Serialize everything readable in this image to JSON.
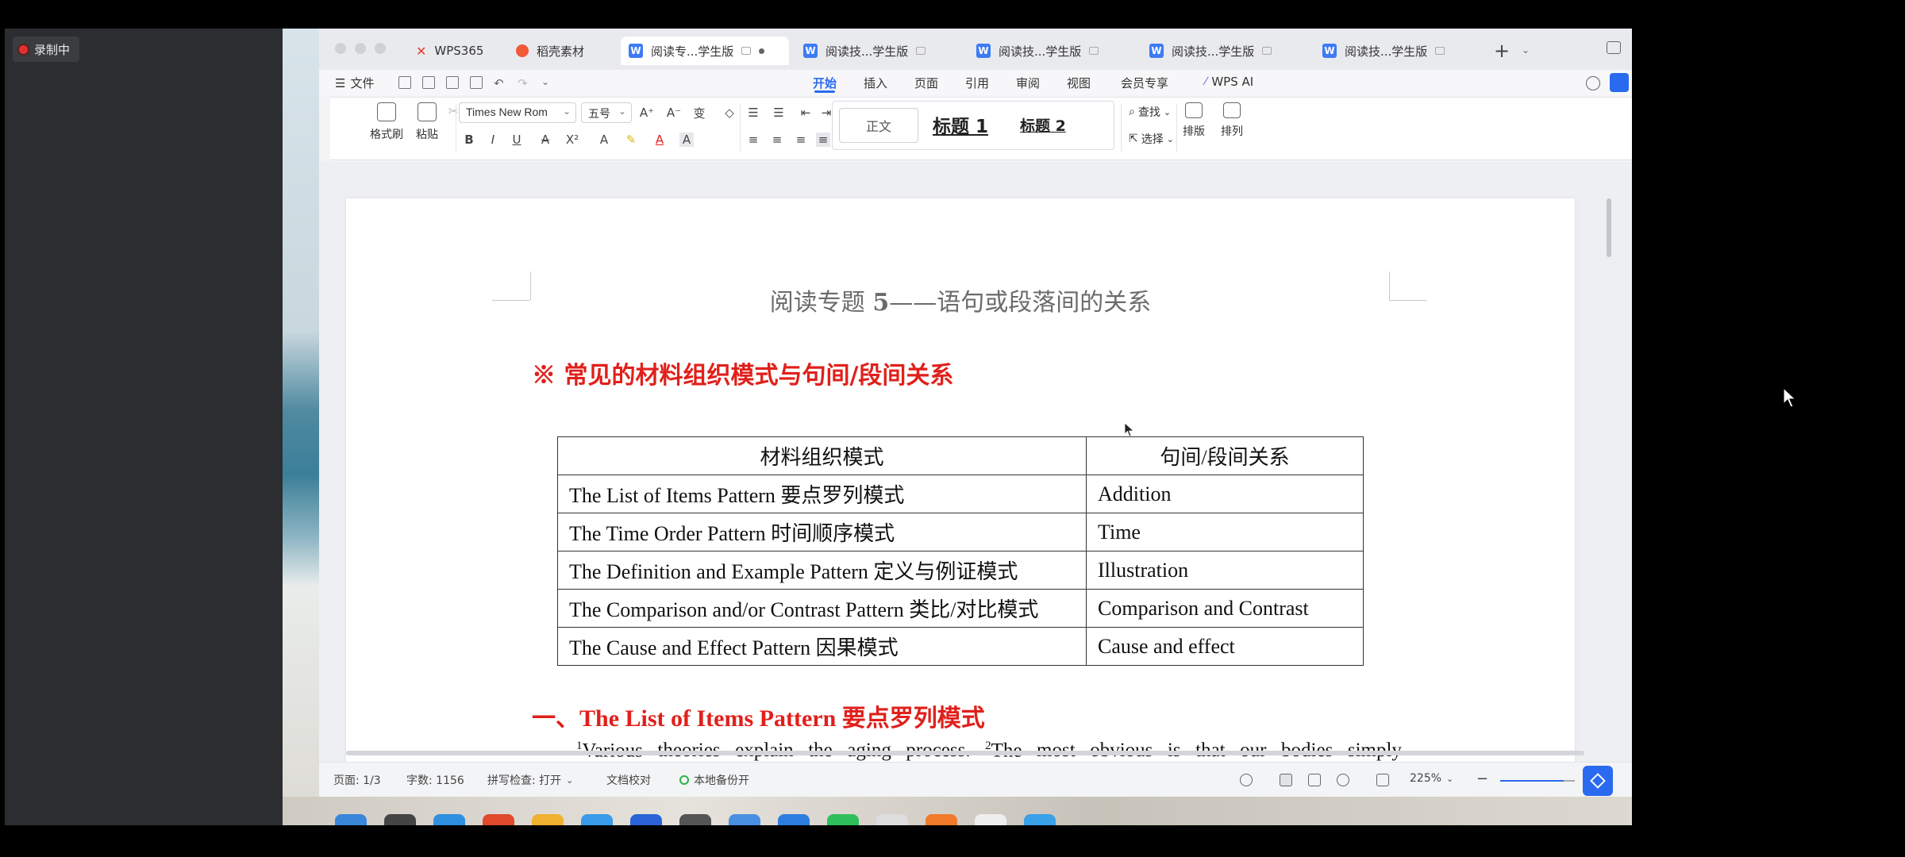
{
  "recorder": {
    "label": "录制中"
  },
  "tabs": [
    {
      "label": "WPS365"
    },
    {
      "label": "稻壳素材"
    },
    {
      "label": "阅读专...学生版",
      "icon": "W"
    },
    {
      "label": "阅读技...学生版",
      "icon": "W"
    },
    {
      "label": "阅读技...学生版",
      "icon": "W"
    },
    {
      "label": "阅读技...学生版",
      "icon": "W"
    },
    {
      "label": "阅读技...学生版",
      "icon": "W"
    }
  ],
  "new_tab": "+",
  "menu": {
    "file": "文件",
    "items": [
      "开始",
      "插入",
      "页面",
      "引用",
      "审阅",
      "视图",
      "会员专享"
    ],
    "ai": "WPS AI"
  },
  "ribbon": {
    "format_painter": "格式刷",
    "paste": "粘贴",
    "font_name": "Times New Rom",
    "font_size": "五号",
    "style_normal": "正文",
    "style_h1": "标题 1",
    "style_h2": "标题 2",
    "find": "查找",
    "select": "选择",
    "layout": "排版",
    "arrange": "排列"
  },
  "document": {
    "title_pre": "阅读专题 ",
    "title_num": "5",
    "title_post": "——语句或段落间的关系",
    "section_heading": "※  常见的材料组织模式与句间/段间关系",
    "table": {
      "headers": [
        "材料组织模式",
        "句间/段间关系"
      ],
      "rows": [
        [
          "The List of Items Pattern    要点罗列模式",
          "Addition"
        ],
        [
          "The Time Order Pattern  时间顺序模式",
          "Time"
        ],
        [
          "The Definition and Example Pattern  定义与例证模式",
          "Illustration"
        ],
        [
          "The Comparison and/or Contrast Pattern  类比/对比模式",
          "Comparison and Contrast"
        ],
        [
          "The Cause and Effect Pattern  因果模式",
          "Cause and effect"
        ]
      ]
    },
    "subheading": "一、The List of Items Pattern  要点罗列模式",
    "body_words": [
      {
        "sup": "1",
        "text": "Various"
      },
      {
        "text": "theories"
      },
      {
        "text": "explain"
      },
      {
        "text": "the"
      },
      {
        "text": "aging"
      },
      {
        "text": "process."
      },
      {
        "sup": "2",
        "text": "The"
      },
      {
        "text": "most"
      },
      {
        "text": "obvious"
      },
      {
        "text": "is"
      },
      {
        "text": "that"
      },
      {
        "text": "our"
      },
      {
        "text": "bodies"
      },
      {
        "text": "simply"
      }
    ]
  },
  "status": {
    "page": "页面: 1/3",
    "words": "字数: 1156",
    "spell": "拼写检查: 打开",
    "proof": "文档校对",
    "backup": "本地备份开",
    "zoom": "225%"
  },
  "colors": {
    "accent": "#2a6af0",
    "heading_red": "#e0201b",
    "title_gray": "#6b6b6b"
  }
}
